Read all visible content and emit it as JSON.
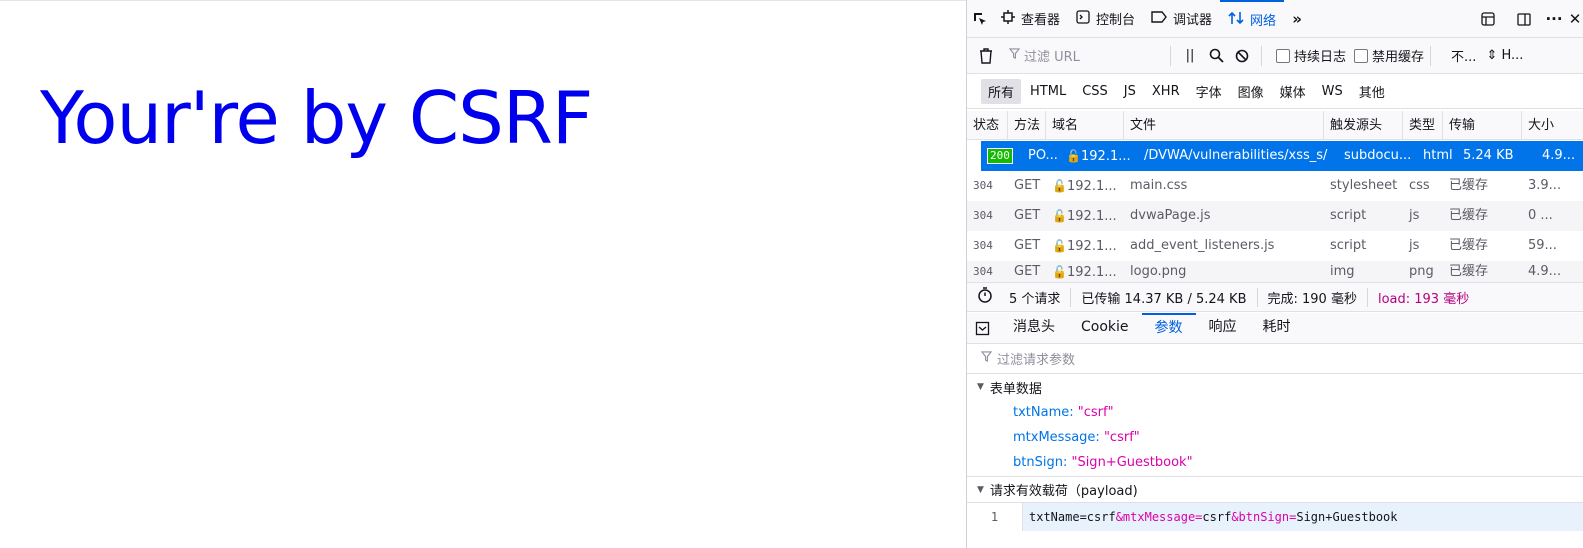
{
  "page": {
    "heading": "Your're by CSRF"
  },
  "devtools": {
    "tabs": [
      {
        "label": "查看器",
        "icon": "inspector-icon"
      },
      {
        "label": "控制台",
        "icon": "console-icon"
      },
      {
        "label": "调试器",
        "icon": "debugger-icon"
      },
      {
        "label": "网络",
        "icon": "network-icon",
        "active": true
      }
    ],
    "toolbar": {
      "filter_placeholder": "过滤 URL",
      "pause_label": "||",
      "persist_label": "持续日志",
      "disable_cache_label": "禁用缓存",
      "throttle_label": "不...",
      "har_label": "H..."
    },
    "type_filters": [
      "所有",
      "HTML",
      "CSS",
      "JS",
      "XHR",
      "字体",
      "图像",
      "媒体",
      "WS",
      "其他"
    ],
    "columns": [
      "状态",
      "方法",
      "域名",
      "文件",
      "触发源头",
      "类型",
      "传输",
      "大小"
    ],
    "requests": [
      {
        "status": "200",
        "method": "PO...",
        "domain": "192.1...",
        "file": "/DVWA/vulnerabilities/xss_s/",
        "cause": "subdocu...",
        "type": "html",
        "transferred": "5.24 KB",
        "size": "4.9...",
        "selected": true
      },
      {
        "status": "304",
        "method": "GET",
        "domain": "192.1...",
        "file": "main.css",
        "cause": "stylesheet",
        "type": "css",
        "transferred": "已缓存",
        "size": "3.9..."
      },
      {
        "status": "304",
        "method": "GET",
        "domain": "192.1...",
        "file": "dvwaPage.js",
        "cause": "script",
        "type": "js",
        "transferred": "已缓存",
        "size": "0 ..."
      },
      {
        "status": "304",
        "method": "GET",
        "domain": "192.1...",
        "file": "add_event_listeners.js",
        "cause": "script",
        "type": "js",
        "transferred": "已缓存",
        "size": "59..."
      },
      {
        "status": "304",
        "method": "GET",
        "domain": "192.1...",
        "file": "logo.png",
        "cause": "img",
        "type": "png",
        "transferred": "已缓存",
        "size": "4.9..."
      }
    ],
    "summary": {
      "count": "5 个请求",
      "transferred": "已传输 14.37 KB / 5.24 KB",
      "finish": "完成: 190 毫秒",
      "load": "load: 193 毫秒"
    },
    "detail_tabs": [
      "消息头",
      "Cookie",
      "参数",
      "响应",
      "耗时"
    ],
    "active_detail_tab": "参数",
    "params_filter_placeholder": "过滤请求参数",
    "form_data": {
      "title": "表单数据",
      "items": [
        {
          "key": "txtName:",
          "value": "\"csrf\""
        },
        {
          "key": "mtxMessage:",
          "value": "\"csrf\""
        },
        {
          "key": "btnSign:",
          "value": "\"Sign+Guestbook\""
        }
      ]
    },
    "payload": {
      "title": "请求有效载荷（payload)",
      "line_number": "1",
      "parts": [
        {
          "text": "txtName=",
          "kind": "key"
        },
        {
          "text": "csrf",
          "kind": "val"
        },
        {
          "text": "&mtxMessage=",
          "kind": "key2"
        },
        {
          "text": "csrf",
          "kind": "val2"
        },
        {
          "text": "&btnSign=",
          "kind": "key3"
        },
        {
          "text": "Sign+Guestbook",
          "kind": "val3"
        }
      ]
    }
  }
}
